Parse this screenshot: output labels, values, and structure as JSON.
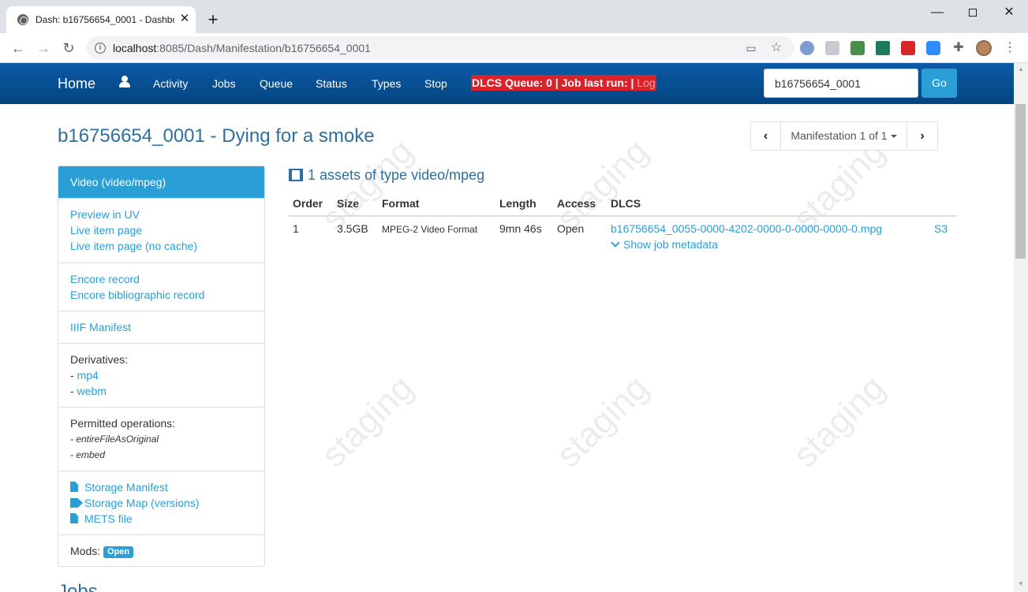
{
  "browser": {
    "tab_title": "Dash: b16756654_0001 - Dashbo",
    "url_host": "localhost",
    "url_rest": ":8085/Dash/Manifestation/b16756654_0001"
  },
  "nav": {
    "brand": "Home",
    "links": [
      "Activity",
      "Jobs",
      "Queue",
      "Status",
      "Types",
      "Stop"
    ],
    "status_text": "DLCS Queue: 0 | Job last run: | ",
    "status_log": "Log",
    "search_value": "b16756654_0001",
    "go_label": "Go"
  },
  "page": {
    "title": "b16756654_0001 - Dying for a smoke",
    "pager_label": "Manifestation 1 of 1"
  },
  "panel": {
    "heading": "Video (video/mpeg)",
    "links_view": [
      "Preview in UV",
      "Live item page",
      "Live item page (no cache)"
    ],
    "links_encore": [
      "Encore record",
      "Encore bibliographic record"
    ],
    "iiif_link": "IIIF Manifest",
    "derivatives_label": "Derivatives:",
    "derivatives": [
      "mp4",
      "webm"
    ],
    "permitted_label": "Permitted operations:",
    "permitted": [
      "- entireFileAsOriginal",
      "- embed"
    ],
    "storage_links": [
      "Storage Manifest",
      "Storage Map (versions)",
      "METS file"
    ],
    "mods_label": "Mods:",
    "mods_badge": "Open"
  },
  "assets": {
    "heading": "1 assets of type video/mpeg",
    "columns": [
      "Order",
      "Size",
      "Format",
      "Length",
      "Access",
      "DLCS"
    ],
    "row": {
      "order": "1",
      "size": "3.5GB",
      "format": "MPEG-2 Video Format",
      "length": "9mn 46s",
      "access": "Open",
      "dlcs": "b16756654_0055-0000-4202-0000-0-0000-0000-0.mpg",
      "storage": "S3"
    },
    "job_metadata": "Show job metadata"
  },
  "jobs_heading": "Jobs",
  "watermark": "staging",
  "colors": {
    "navbar": "#03457f",
    "primary": "#2a9fd6",
    "danger": "#d9232b",
    "heading": "#2f6f9f"
  }
}
